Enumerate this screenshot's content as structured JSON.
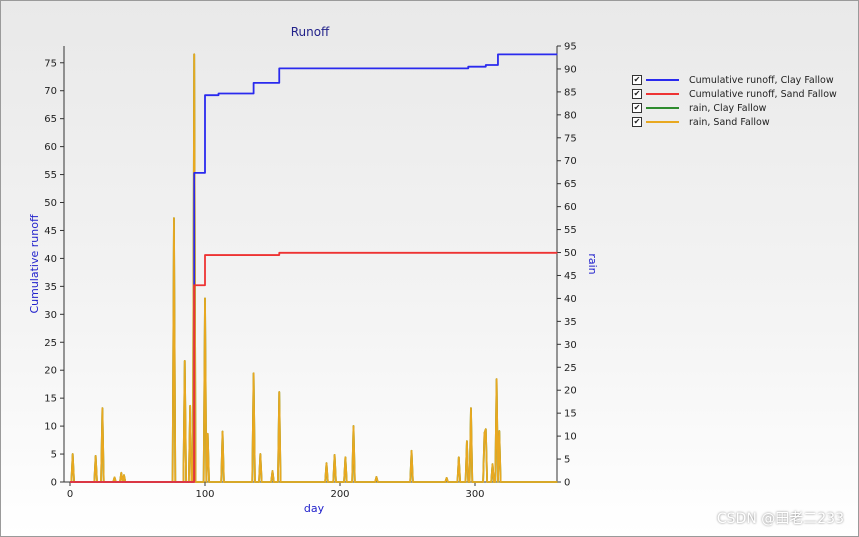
{
  "chart_data": {
    "type": "line",
    "title": "Runoff",
    "xlabel": "day",
    "ylabel": "Cumulative runoff",
    "y2label": "rain",
    "xlim": [
      0,
      361
    ],
    "ylim": [
      0,
      78
    ],
    "y2lim": [
      0,
      95
    ],
    "xticks": [
      0,
      100,
      200,
      300
    ],
    "yticks": [
      0,
      5,
      10,
      15,
      20,
      25,
      30,
      35,
      40,
      45,
      50,
      55,
      60,
      65,
      70,
      75
    ],
    "y2ticks": [
      0,
      5,
      10,
      15,
      20,
      25,
      30,
      35,
      40,
      45,
      50,
      55,
      60,
      65,
      70,
      75,
      80,
      85,
      90,
      95
    ],
    "grid": false,
    "legend_position": "right",
    "series": [
      {
        "name": "Cumulative runoff, Clay Fallow",
        "axis": "left",
        "color": "#2a2aee",
        "step": true,
        "points": [
          [
            0,
            0
          ],
          [
            91,
            0
          ],
          [
            92,
            55.3
          ],
          [
            100,
            69.2
          ],
          [
            110,
            69.5
          ],
          [
            136,
            71.4
          ],
          [
            155,
            74.0
          ],
          [
            295,
            74.3
          ],
          [
            308,
            74.6
          ],
          [
            317,
            76.5
          ],
          [
            361,
            76.5
          ]
        ]
      },
      {
        "name": "Cumulative runoff, Sand Fallow",
        "axis": "left",
        "color": "#ee3333",
        "step": true,
        "points": [
          [
            0,
            0
          ],
          [
            91,
            0
          ],
          [
            92,
            35.2
          ],
          [
            100,
            40.6
          ],
          [
            155,
            41.0
          ],
          [
            361,
            41.0
          ]
        ]
      },
      {
        "name": "rain, Clay Fallow",
        "axis": "right",
        "color": "#2e8b2e",
        "events": [
          [
            2,
            6.1
          ],
          [
            19,
            5.7
          ],
          [
            24,
            16.1
          ],
          [
            33,
            1
          ],
          [
            38,
            2
          ],
          [
            40,
            1.5
          ],
          [
            77,
            57.5
          ],
          [
            85,
            26.4
          ],
          [
            89,
            16.6
          ],
          [
            92,
            93.2
          ],
          [
            100,
            40
          ],
          [
            102,
            10.5
          ],
          [
            113,
            11
          ],
          [
            136,
            23.7
          ],
          [
            141,
            6.1
          ],
          [
            150,
            2.4
          ],
          [
            155,
            19.6
          ],
          [
            190,
            4.1
          ],
          [
            196,
            5.9
          ],
          [
            204,
            5.4
          ],
          [
            210,
            12.2
          ],
          [
            227,
            1.1
          ],
          [
            253,
            6.8
          ],
          [
            279,
            0.9
          ],
          [
            288,
            5.4
          ],
          [
            294,
            8.9
          ],
          [
            297,
            16.1
          ],
          [
            307,
            10.7
          ],
          [
            308,
            11.5
          ],
          [
            313,
            3.9
          ],
          [
            316,
            22.4
          ],
          [
            318,
            11.1
          ]
        ]
      },
      {
        "name": "rain, Sand Fallow",
        "axis": "right",
        "color": "#e8a820",
        "events": [
          [
            2,
            6.1
          ],
          [
            19,
            5.7
          ],
          [
            24,
            16.1
          ],
          [
            33,
            1
          ],
          [
            38,
            2
          ],
          [
            40,
            1.5
          ],
          [
            77,
            57.5
          ],
          [
            85,
            26.4
          ],
          [
            89,
            16.6
          ],
          [
            92,
            93.2
          ],
          [
            100,
            40
          ],
          [
            102,
            10.5
          ],
          [
            113,
            11
          ],
          [
            136,
            23.7
          ],
          [
            141,
            6.1
          ],
          [
            150,
            2.4
          ],
          [
            155,
            19.6
          ],
          [
            190,
            4.1
          ],
          [
            196,
            5.9
          ],
          [
            204,
            5.4
          ],
          [
            210,
            12.2
          ],
          [
            227,
            1.1
          ],
          [
            253,
            6.8
          ],
          [
            279,
            0.9
          ],
          [
            288,
            5.4
          ],
          [
            294,
            8.9
          ],
          [
            297,
            16.1
          ],
          [
            307,
            10.7
          ],
          [
            308,
            11.5
          ],
          [
            313,
            3.9
          ],
          [
            316,
            22.4
          ],
          [
            318,
            11.1
          ]
        ]
      }
    ]
  },
  "watermark": "CSDN @田老二233",
  "check_mark": "✔"
}
